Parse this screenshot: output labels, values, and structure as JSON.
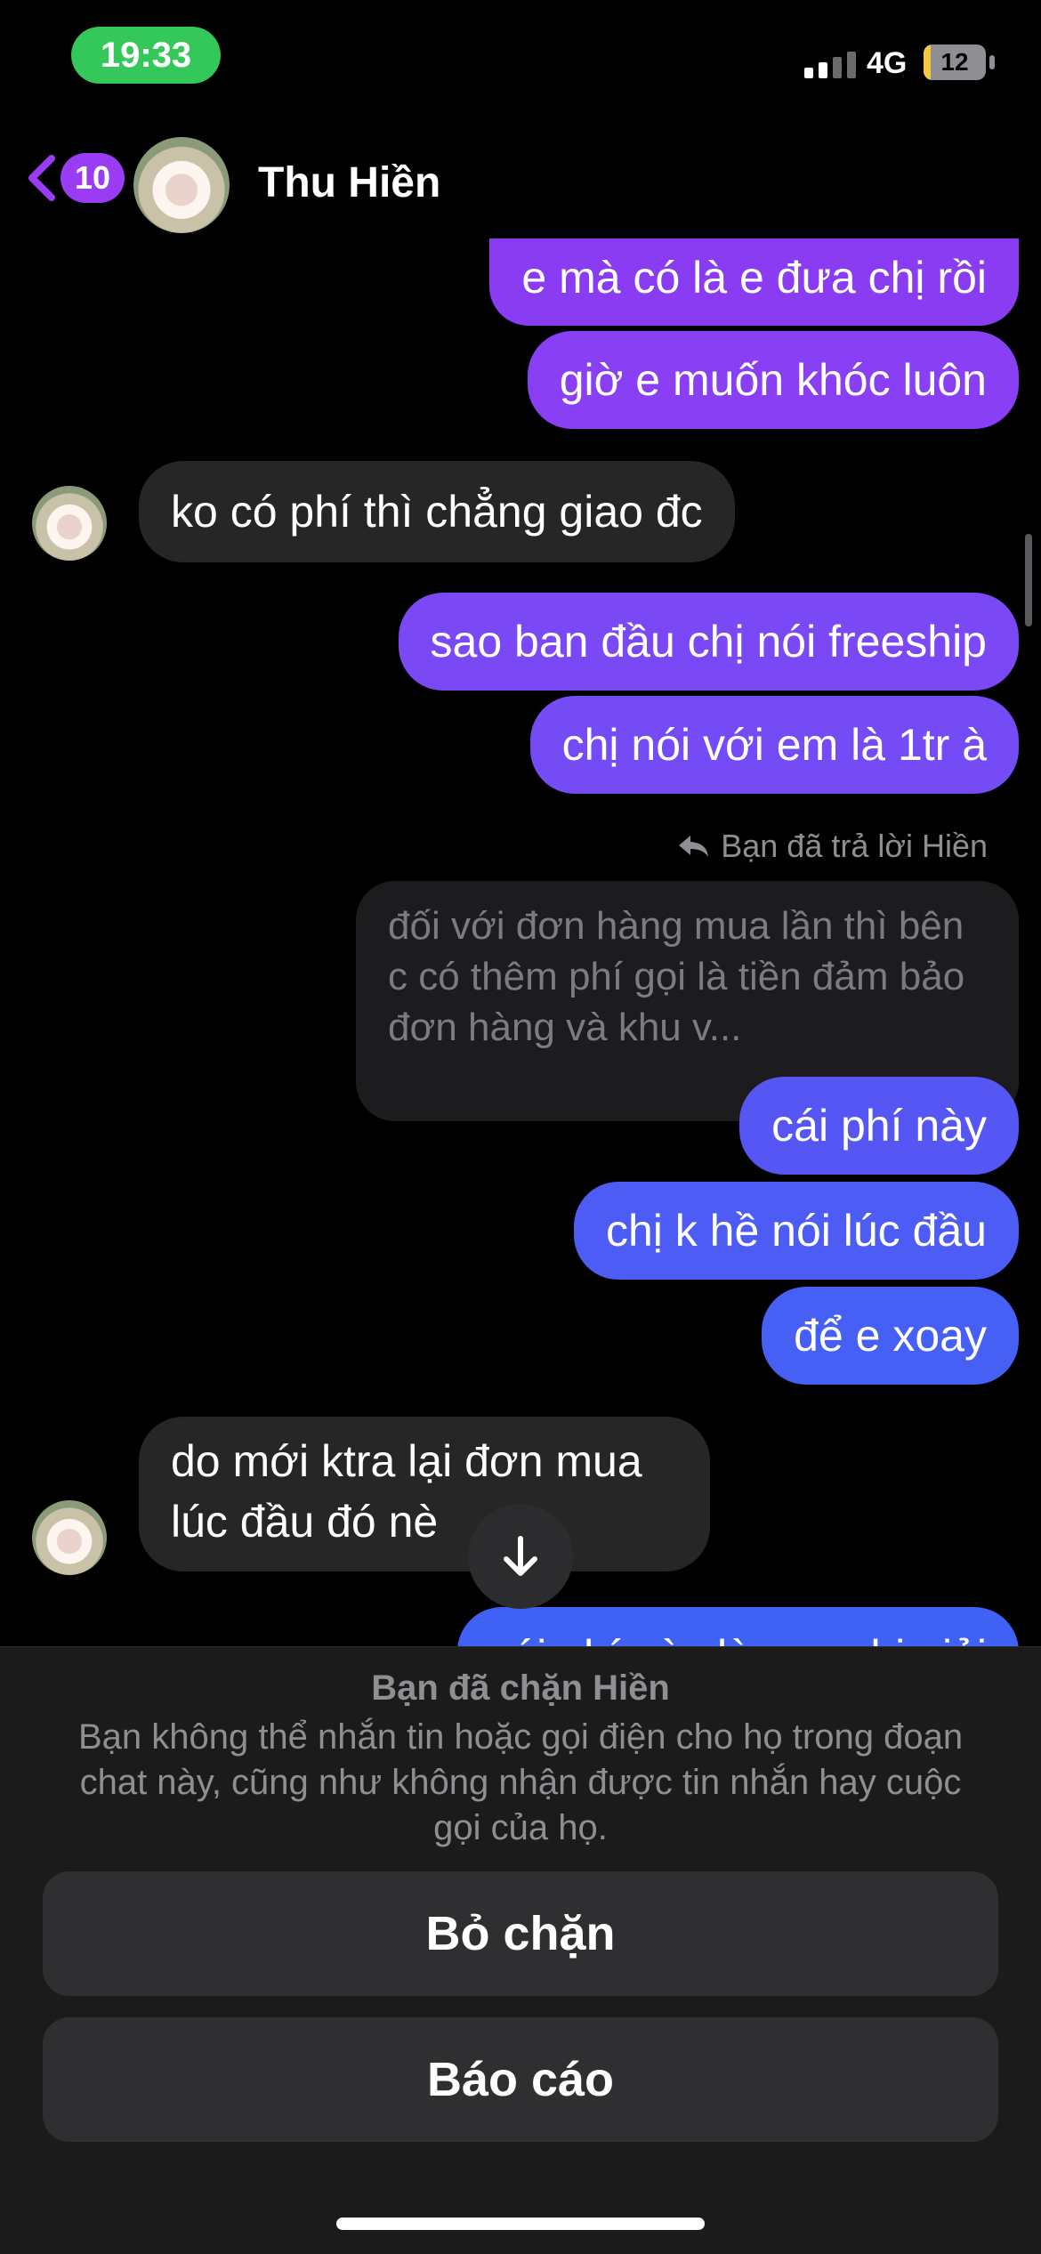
{
  "status": {
    "time": "19:33",
    "network": "4G",
    "battery": "12",
    "battery_level": 0.12
  },
  "header": {
    "back_count": "10",
    "contact_name": "Thu Hiền"
  },
  "messages": [
    {
      "side": "out",
      "text": "e mà có là e đưa chị rồi"
    },
    {
      "side": "out",
      "text": "giờ e muốn khóc luôn"
    },
    {
      "side": "in",
      "text": "ko có phí thì chẳng giao đc"
    },
    {
      "side": "out",
      "text": "sao ban đầu chị nói freeship"
    },
    {
      "side": "out",
      "text": "chị nói với em là 1tr à"
    },
    {
      "side": "out",
      "text": "cái phí này"
    },
    {
      "side": "out",
      "text": "chị k hề nói lúc đầu"
    },
    {
      "side": "out",
      "text": "để e xoay"
    },
    {
      "side": "in",
      "text": "do mới ktra lại đơn mua lúc đầu đó nè"
    },
    {
      "side": "out",
      "text": "cái phí này là sao chị giải"
    }
  ],
  "reply": {
    "label": "Bạn đã trả lời Hiền",
    "quoted_text": "đối với đơn hàng mua lần thì bên c có thêm phí gọi là tiền đảm bảo đơn hàng và khu v..."
  },
  "blocked": {
    "title": "Bạn đã chặn Hiền",
    "description": "Bạn không thể nhắn tin hoặc gọi điện cho họ trong đoạn chat này, cũng như không nhận được tin nhắn hay cuộc gọi của họ.",
    "unblock_label": "Bỏ chặn",
    "report_label": "Báo cáo"
  },
  "colors": {
    "accent": "#9b3cf5",
    "outgoing_top": "#8a3df5",
    "outgoing_bottom": "#3f62f5",
    "incoming": "#262626"
  },
  "icons": [
    "back-chevron-icon",
    "reply-arrow-icon",
    "arrow-down-icon"
  ]
}
